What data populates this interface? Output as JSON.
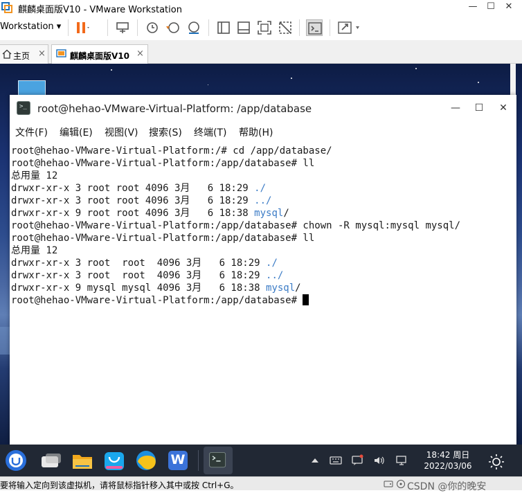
{
  "vmware": {
    "window_title": "麒麟桌面版V10 - VMware Workstation",
    "minimize": "—",
    "maximize": "☐",
    "close": "✕",
    "workstation_menu": "Workstation ▾",
    "tabs": [
      {
        "label": "主页",
        "icon": "home-icon"
      },
      {
        "label": "麒麟桌面版V10",
        "icon": "vm-icon"
      }
    ],
    "tab_close": "×",
    "status_text": "要将输入定向到该虚拟机，请将鼠标指针移入其中或按 Ctrl+G。",
    "watermark": "CSDN @你的晚安"
  },
  "terminal": {
    "title": "root@hehao-VMware-Virtual-Platform: /app/database",
    "icon_glyph": ">_",
    "minimize": "—",
    "maximize": "☐",
    "close": "✕",
    "menu": [
      "文件(F)",
      "编辑(E)",
      "视图(V)",
      "搜索(S)",
      "终端(T)",
      "帮助(H)"
    ],
    "lines": [
      {
        "text": "root@hehao-VMware-Virtual-Platform:/# cd /app/database/",
        "dir": "",
        "tail": ""
      },
      {
        "text": "root@hehao-VMware-Virtual-Platform:/app/database# ll",
        "dir": "",
        "tail": ""
      },
      {
        "text": "总用量 12",
        "dir": "",
        "tail": ""
      },
      {
        "text": "drwxr-xr-x 3 root root 4096 3月   6 18:29 ",
        "dir": "./",
        "tail": ""
      },
      {
        "text": "drwxr-xr-x 3 root root 4096 3月   6 18:29 ",
        "dir": "../",
        "tail": ""
      },
      {
        "text": "drwxr-xr-x 9 root root 4096 3月   6 18:38 ",
        "dir": "mysql",
        "tail": "/"
      },
      {
        "text": "root@hehao-VMware-Virtual-Platform:/app/database# chown -R mysql:mysql mysql/",
        "dir": "",
        "tail": ""
      },
      {
        "text": "root@hehao-VMware-Virtual-Platform:/app/database# ll",
        "dir": "",
        "tail": ""
      },
      {
        "text": "总用量 12",
        "dir": "",
        "tail": ""
      },
      {
        "text": "drwxr-xr-x 3 root  root  4096 3月   6 18:29 ",
        "dir": "./",
        "tail": ""
      },
      {
        "text": "drwxr-xr-x 3 root  root  4096 3月   6 18:29 ",
        "dir": "../",
        "tail": ""
      },
      {
        "text": "drwxr-xr-x 9 mysql mysql 4096 3月   6 18:38 ",
        "dir": "mysql",
        "tail": "/"
      },
      {
        "text": "root@hehao-VMware-Virtual-Platform:/app/database# ",
        "dir": "",
        "tail": ""
      }
    ]
  },
  "taskbar": {
    "apps": [
      "start-menu-icon",
      "multitask-view-icon",
      "file-manager-icon",
      "app-store-icon",
      "browser-icon",
      "wps-office-icon",
      "terminal-icon"
    ],
    "wps_letter": "W",
    "tray": [
      "arrow-up-icon",
      "keyboard-icon",
      "notification-icon",
      "volume-icon",
      "network-icon"
    ],
    "time": "18:42 周日",
    "date": "2022/03/06",
    "colors": {
      "taskbar_bg": "#212834",
      "accent": "#3c7cc6"
    }
  }
}
